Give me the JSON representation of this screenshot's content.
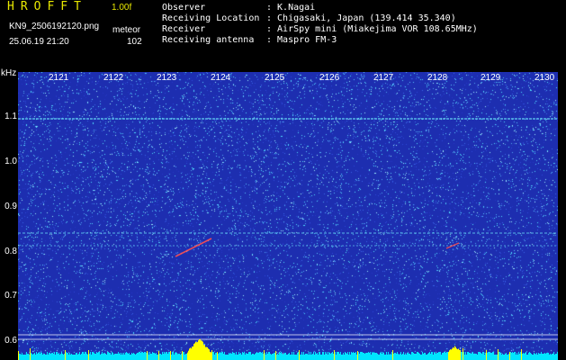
{
  "header": {
    "app_title": "HROFFT",
    "version": "1.00f",
    "filename": "KN9_2506192120.png",
    "datetime": "25.06.19 21:20",
    "meteor_label": "meteor",
    "meteor_count": "102"
  },
  "info": [
    {
      "label": "Observer",
      "value": ": K.Nagai"
    },
    {
      "label": "Receiving Location",
      "value": ": Chigasaki, Japan (139.414 35.340)"
    },
    {
      "label": "Receiver",
      "value": ": AirSpy mini (Miakejima VOR 108.65MHz)"
    },
    {
      "label": "Receiving antenna",
      "value": ": Maspro FM-3"
    }
  ],
  "axes": {
    "y_unit": "kHz",
    "y_ticks": [
      "1.1",
      "1.0",
      "0.9",
      "0.8",
      "0.7",
      "0.6"
    ],
    "x_ticks": [
      "2121",
      "2122",
      "2123",
      "2124",
      "2125",
      "2126",
      "2127",
      "2128",
      "2129",
      "2130"
    ]
  },
  "colors": {
    "background": "#000000",
    "title": "#e8e800",
    "spectrum_bg": "#1d2eb0",
    "noise_cyan": "#4fe0ff",
    "signal_line": "#6ff0ff",
    "meteor_echo": "#ff5050",
    "level_bar_base": "#00e5ff",
    "level_bar_peak": "#ffff00"
  }
}
